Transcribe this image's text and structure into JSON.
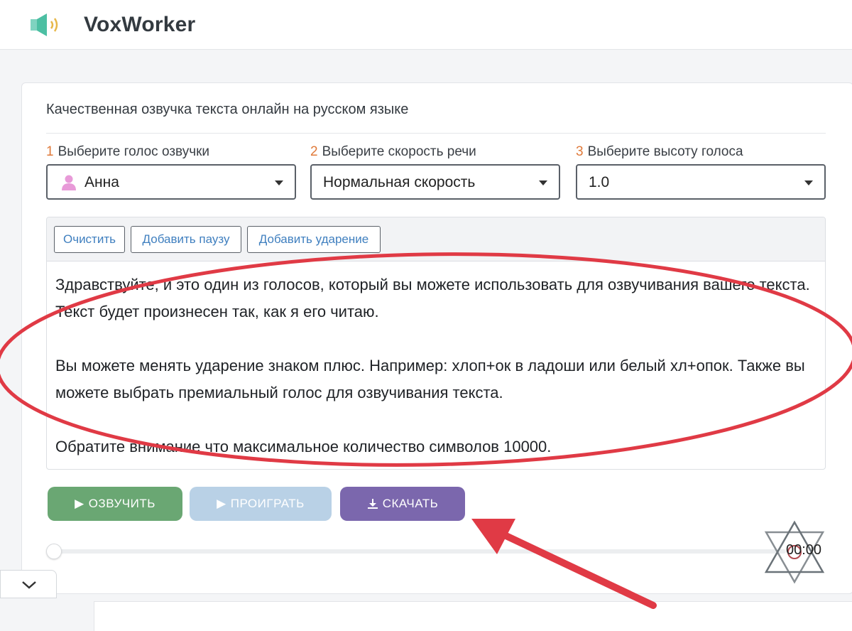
{
  "app": {
    "brand": "VoxWorker",
    "logo_icon": "speaker-icon"
  },
  "card": {
    "subtitle": "Качественная озвучка текста онлайн на русском языке"
  },
  "selects": [
    {
      "num": "1",
      "label": "Выберите голос озвучки",
      "value": "Анна",
      "icon": "user-icon"
    },
    {
      "num": "2",
      "label": "Выберите скорость речи",
      "value": "Нормальная скорость"
    },
    {
      "num": "3",
      "label": "Выберите высоту голоса",
      "value": "1.0"
    }
  ],
  "toolbar": {
    "clear": "Очистить",
    "add_pause": "Добавить паузу",
    "add_stress": "Добавить ударение"
  },
  "editor": {
    "p1": "Здравствуйте, и это один из голосов, который вы можете использовать для озвучивания вашего текста. Текст будет произнесен так, как я его читаю.",
    "p2": "Вы можете менять ударение знаком плюс. Например: хлоп+ок в ладоши или белый хл+опок. Также вы можете выбрать премиальный голос для озвучивания текста.",
    "p3": "Обратите внимание что максимальное количество символов 10000."
  },
  "actions": {
    "speak": "ОЗВУЧИТЬ",
    "play": "ПРОИГРАТЬ",
    "download": "СКАЧАТЬ"
  },
  "player": {
    "time": "00:00",
    "progress": 0
  },
  "colors": {
    "speak": "#6aa773",
    "play": "#b9d1e6",
    "download": "#7b67ad",
    "annotation": "#e03a45",
    "number": "#e07a3a"
  },
  "collapse": {
    "icon": "chevron-down-icon"
  }
}
